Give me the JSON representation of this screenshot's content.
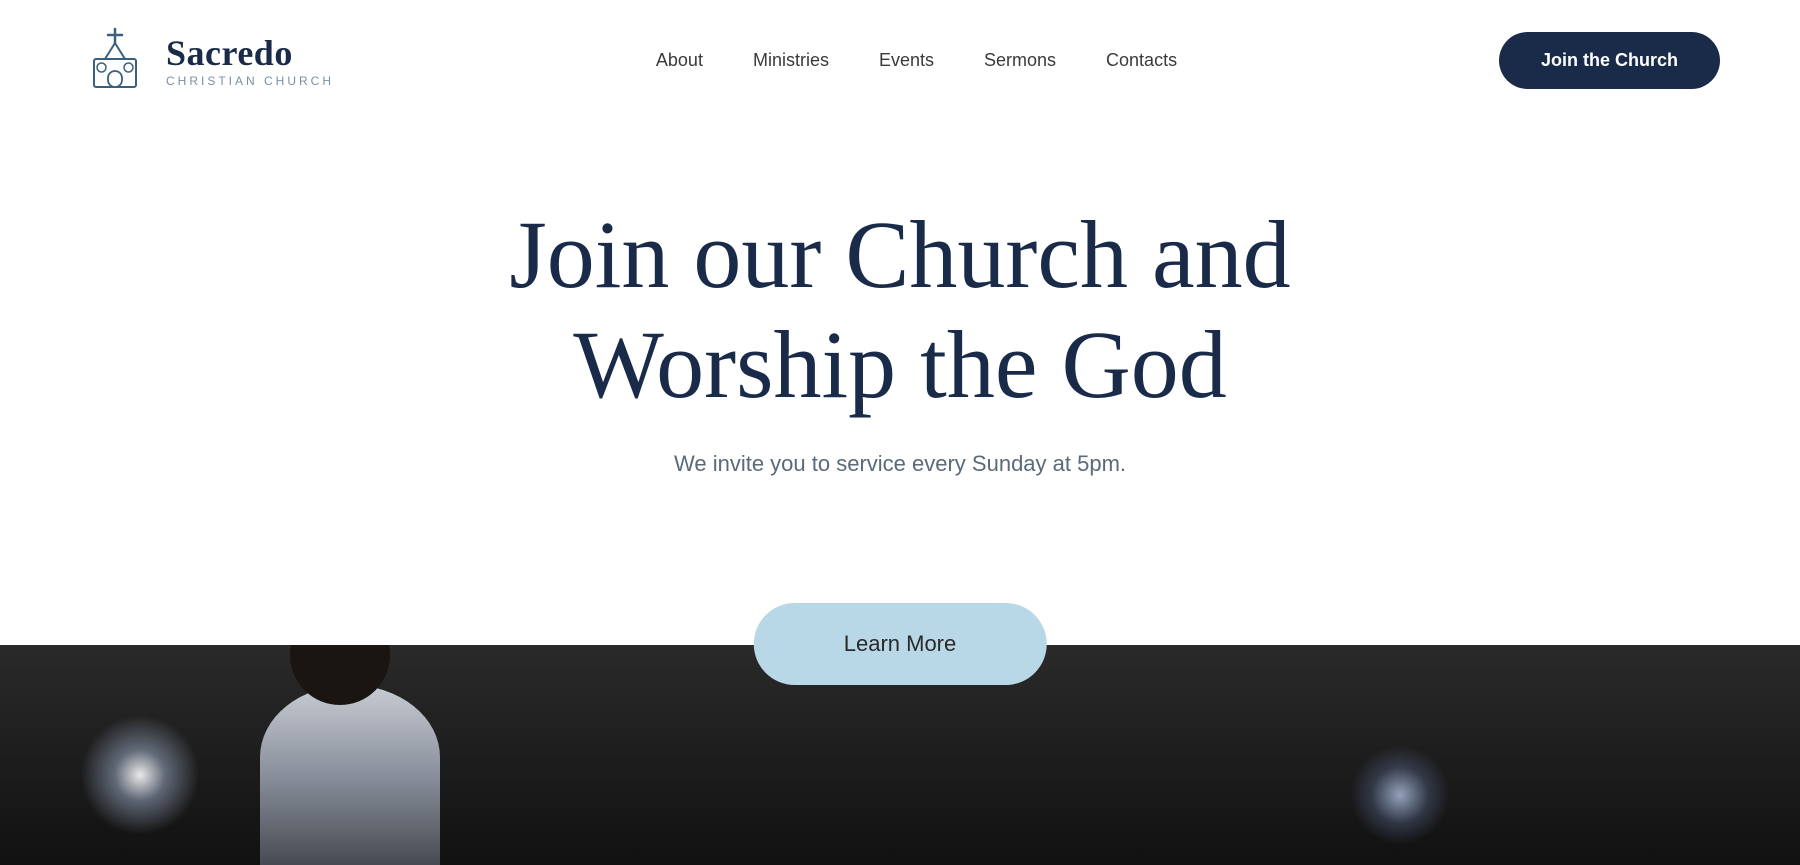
{
  "header": {
    "logo": {
      "name": "Sacredo",
      "subtitle": "CHRISTIAN CHURCH"
    },
    "nav": {
      "items": [
        {
          "label": "About",
          "id": "about"
        },
        {
          "label": "Ministries",
          "id": "ministries"
        },
        {
          "label": "Events",
          "id": "events"
        },
        {
          "label": "Sermons",
          "id": "sermons"
        },
        {
          "label": "Contacts",
          "id": "contacts"
        }
      ]
    },
    "cta": {
      "label": "Join the Church"
    }
  },
  "hero": {
    "title_line1": "Join our Church and",
    "title_line2": "Worship the God",
    "subtitle": "We invite you to service every Sunday at 5pm.",
    "learn_more_label": "Learn More"
  },
  "colors": {
    "navy": "#1a2b4a",
    "light_blue_btn": "#b8d8e8",
    "text_gray": "#5a6a7a",
    "logo_subtitle": "#7a8fa6"
  }
}
